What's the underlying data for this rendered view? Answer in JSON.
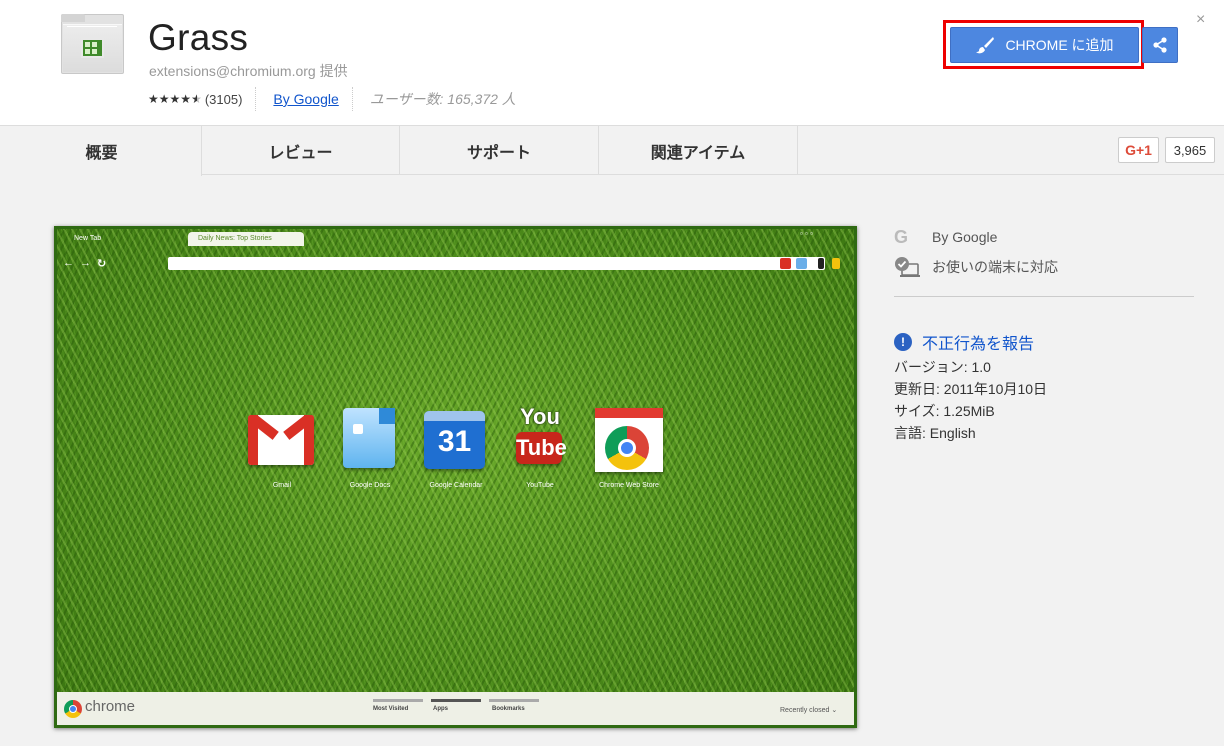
{
  "extension": {
    "title": "Grass",
    "provider": "extensions@chromium.org 提供",
    "rating_count": "(3105)",
    "by_link": "By Google",
    "users": "ユーザー数: 165,372 人",
    "stars": 4.5
  },
  "actions": {
    "add_label": "CHROME に追加",
    "close": "×"
  },
  "tabs": [
    {
      "label": "概要",
      "active": true
    },
    {
      "label": "レビュー",
      "active": false
    },
    {
      "label": "サポート",
      "active": false
    },
    {
      "label": "関連アイテム",
      "active": false
    }
  ],
  "social": {
    "gplus_label": "G+1",
    "gplus_count": "3,965"
  },
  "screenshot": {
    "browser_tabs": [
      "New Tab",
      "Daily News: Top Stories"
    ],
    "apps": [
      "Gmail",
      "Google Docs",
      "Google Calendar",
      "YouTube",
      "Chrome Web Store"
    ],
    "calendar_day": "31",
    "youtube_you": "You",
    "youtube_tube": "Tube",
    "chrome_word": "chrome",
    "bottom_tabs": [
      "Most Visited",
      "Apps",
      "Bookmarks"
    ],
    "recently_closed": "Recently closed ⌄"
  },
  "side": {
    "by": "By Google",
    "compat": "お使いの端末に対応",
    "report": "不正行為を報告",
    "version": "バージョン: 1.0",
    "updated": "更新日: 2011年10月10日",
    "size": "サイズ: 1.25MiB",
    "language": "言語: English"
  },
  "colors": {
    "accent": "#4d87e0",
    "link": "#1155cc",
    "highlight": "#ee0000"
  }
}
